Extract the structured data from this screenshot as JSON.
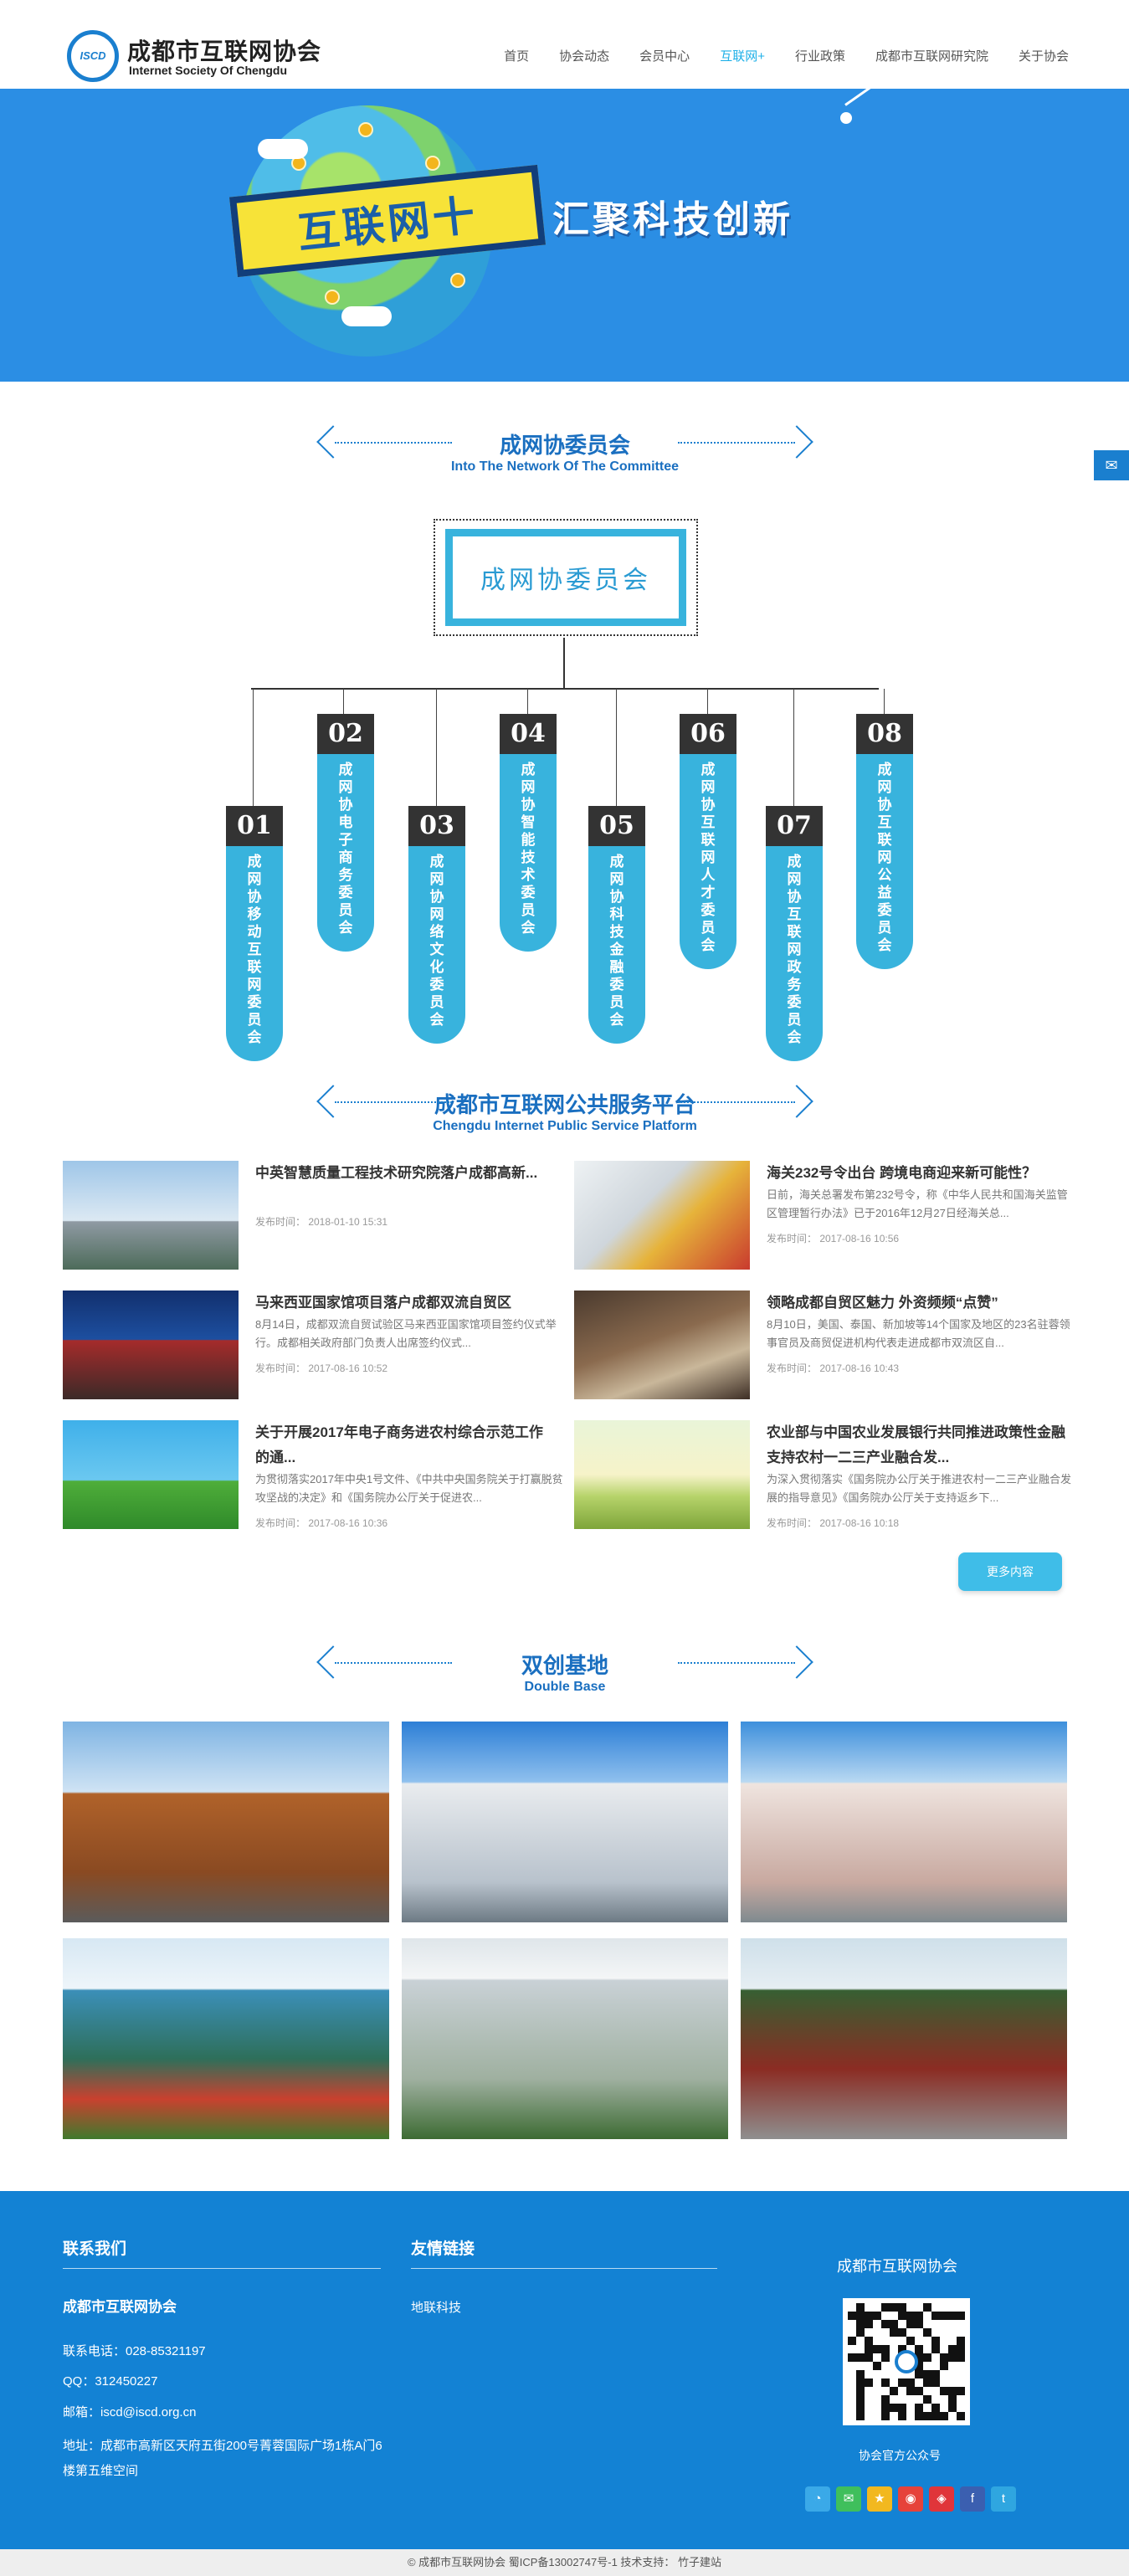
{
  "header": {
    "logo_mark": "ISCD",
    "logo_cn": "成都市互联网协会",
    "logo_en": "Internet Society Of Chengdu",
    "nav": [
      "首页",
      "协会动态",
      "会员中心",
      "互联网+",
      "行业政策",
      "成都市互联网研究院",
      "关于协会"
    ],
    "active_nav": "互联网+"
  },
  "banner": {
    "ribbon_text": "互联网十",
    "slogan": "汇聚科技创新"
  },
  "float_button": {
    "icon": "wechat-icon"
  },
  "committee_section": {
    "title_cn": "成网协委员会",
    "title_en": "Into The Network Of The Committee",
    "box_label": "成网协委员会",
    "items": [
      {
        "num": "01",
        "name": "成网协移动互联网委员会"
      },
      {
        "num": "02",
        "name": "成网协电子商务委员会"
      },
      {
        "num": "03",
        "name": "成网协网络文化委员会"
      },
      {
        "num": "04",
        "name": "成网协智能技术委员会"
      },
      {
        "num": "05",
        "name": "成网协科技金融委员会"
      },
      {
        "num": "06",
        "name": "成网协互联网人才委员会"
      },
      {
        "num": "07",
        "name": "成网协互联网政务委员会"
      },
      {
        "num": "08",
        "name": "成网协互联网公益委员会"
      }
    ]
  },
  "platform_section": {
    "title_cn": "成都市互联网公共服务平台",
    "title_en": "Chengdu Internet Public Service Platform",
    "news": [
      {
        "title": "中英智慧质量工程技术研究院落户成都高新...",
        "desc": "",
        "date": "发布时间：  2018-01-10 15:31"
      },
      {
        "title": "海关232号令出台 跨境电商迎来新可能性？",
        "desc": "日前，海关总署发布第232号令，称《中华人民共和国海关监管区管理暂行办法》已于2016年12月27日经海关总...",
        "date": "发布时间：  2017-08-16 10:56"
      },
      {
        "title": "马来西亚国家馆项目落户成都双流自贸区",
        "desc": "8月14日，成都双流自贸试验区马来西亚国家馆项目签约仪式举行。成都相关政府部门负责人出席签约仪式...",
        "date": "发布时间：  2017-08-16 10:52"
      },
      {
        "title": "领略成都自贸区魅力 外资频频“点赞”",
        "desc": "8月10日，美国、泰国、新加坡等14个国家及地区的23名驻蓉领事官员及商贸促进机构代表走进成都市双流区自...",
        "date": "发布时间：  2017-08-16 10:43"
      },
      {
        "title": "关于开展2017年电子商务进农村综合示范工作的通...",
        "desc": "为贯彻落实2017年中央1号文件、《中共中央国务院关于打赢脱贫攻坚战的决定》和《国务院办公厅关于促进农...",
        "date": "发布时间：  2017-08-16 10:36"
      },
      {
        "title": "农业部与中国农业发展银行共同推进政策性金融 支持农村一二三产业融合发...",
        "desc": "为深入贯彻落实《国务院办公厅关于推进农村一二三产业融合发展的指导意见》《国务院办公厅关于支持返乡下...",
        "date": "发布时间：  2017-08-16 10:18"
      }
    ],
    "more_label": "更多内容"
  },
  "base_section": {
    "title_cn": "双创基地",
    "title_en": "Double Base"
  },
  "footer": {
    "contact_title": "联系我们",
    "org_name": "成都市互联网协会",
    "phone": "联系电话：028-85321197",
    "qq": "QQ：312450227",
    "email": "邮箱：iscd@iscd.org.cn",
    "address": "地址：成都市高新区天府五街200号菁蓉国际广场1栋A门6楼第五维空间",
    "links_title": "友情链接",
    "link_1": "地联科技",
    "qr_title": "成都市互联网协会",
    "qr_caption": "协会官方公众号",
    "social_icons": [
      "qq-icon",
      "wechat-icon",
      "qzone-icon",
      "weibo-icon",
      "tencent-weibo-icon",
      "facebook-icon",
      "twitter-icon"
    ]
  },
  "copyright": "© 成都市互联网协会    蜀ICP备13002747号-1    技术支持： 竹子建站",
  "colors": {
    "brand_blue": "#1382d4",
    "accent_cyan": "#38b3dd",
    "banner_blue": "#2b8ee4"
  }
}
